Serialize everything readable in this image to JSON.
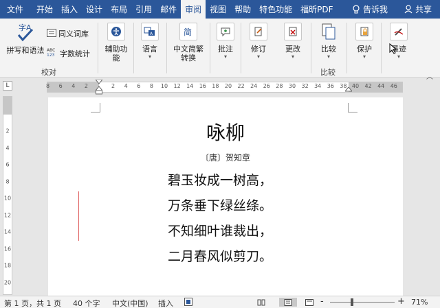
{
  "menu": {
    "tabs": [
      "文件",
      "开始",
      "插入",
      "设计",
      "布局",
      "引用",
      "邮件",
      "审阅",
      "视图",
      "帮助",
      "特色功能",
      "福昕PDF"
    ],
    "active_tab": "审阅",
    "tell_me": "告诉我",
    "share": "共享"
  },
  "ribbon": {
    "spelling": "拼写和语法",
    "thesaurus": "同义词库",
    "word_count": "字数统计",
    "group_proofing": "校对",
    "accessibility_1": "辅助功",
    "accessibility_2": "能",
    "language": "语言",
    "chinese_convert_1": "中文简繁",
    "chinese_convert_2": "转换",
    "comments": "批注",
    "tracking": "修订",
    "changes": "更改",
    "compare": "比较",
    "group_compare": "比较",
    "protect": "保护",
    "ink": "墨迹"
  },
  "ruler": {
    "left_ticks": [
      "8",
      "6",
      "4",
      "2"
    ],
    "ticks": [
      "2",
      "4",
      "6",
      "8",
      "10",
      "12",
      "14",
      "16",
      "18",
      "20",
      "22",
      "24",
      "26",
      "28",
      "30",
      "32",
      "34",
      "36",
      "38"
    ],
    "right_ticks": [
      "40",
      "42",
      "44",
      "46"
    ],
    "vertical_ticks": [
      "2",
      "4",
      "6",
      "8",
      "10",
      "12",
      "14",
      "16",
      "18",
      "20"
    ]
  },
  "document": {
    "title": "咏柳",
    "author": "〔唐〕贺知章",
    "lines": [
      "碧玉妆成一树高，",
      "万条垂下绿丝绦。",
      "不知细叶谁裁出，",
      "二月春风似剪刀。"
    ]
  },
  "status": {
    "page": "第 1 页，共 1 页",
    "words": "40 个字",
    "language": "中文(中国)",
    "mode": "插入",
    "zoom_minus": "-",
    "zoom_plus": "+",
    "zoom": "71%"
  },
  "colors": {
    "accent": "#2b579a"
  }
}
